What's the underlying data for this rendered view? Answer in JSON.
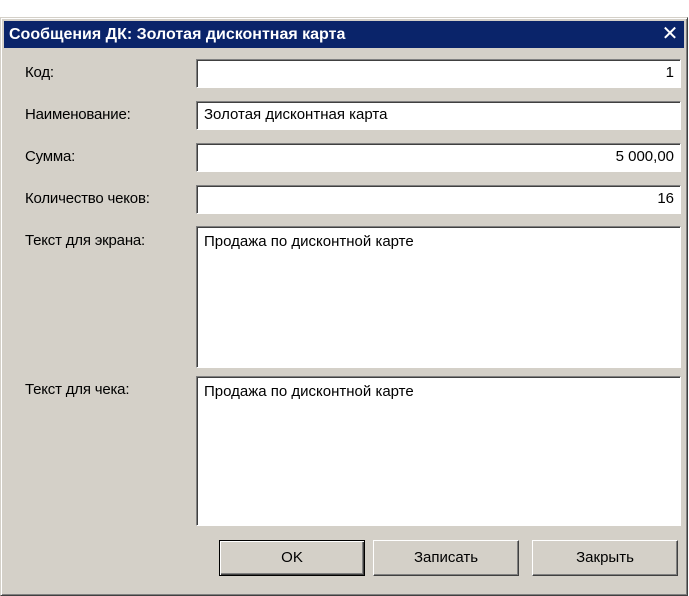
{
  "window": {
    "title": "Сообщения ДК: Золотая дисконтная карта",
    "close_glyph": "✕"
  },
  "form": {
    "code": {
      "label": "Код:",
      "value": "1"
    },
    "name": {
      "label": "Наименование:",
      "value": "Золотая дисконтная карта"
    },
    "sum": {
      "label": "Сумма:",
      "value": "5 000,00"
    },
    "receipts_count": {
      "label": "Количество чеков:",
      "value": "16"
    },
    "screen_text": {
      "label": "Текст для экрана:",
      "value": "Продажа по дисконтной карте"
    },
    "receipt_text": {
      "label": "Текст для чека:",
      "value": "Продажа по дисконтной карте"
    }
  },
  "buttons": {
    "ok": "OK",
    "save": "Записать",
    "close": "Закрыть"
  },
  "colors": {
    "titlebar": "#0a246a",
    "window_face": "#d4d0c8"
  }
}
